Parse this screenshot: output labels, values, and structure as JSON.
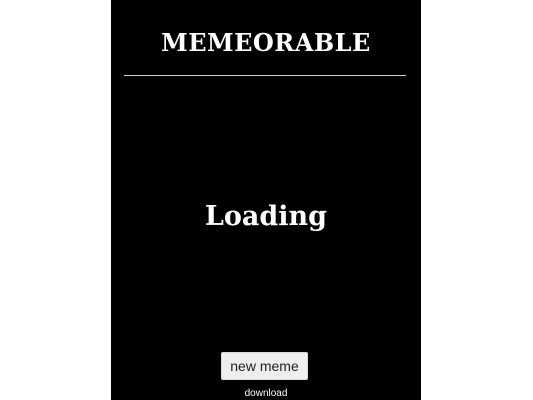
{
  "app": {
    "title": "MEMEORABLE",
    "status_text": "Loading",
    "new_meme_label": "new meme",
    "download_label": "download"
  },
  "colors": {
    "page_background": "#ffffff",
    "app_background": "#000000",
    "text": "#ffffff",
    "button_background": "#eeeeee"
  }
}
